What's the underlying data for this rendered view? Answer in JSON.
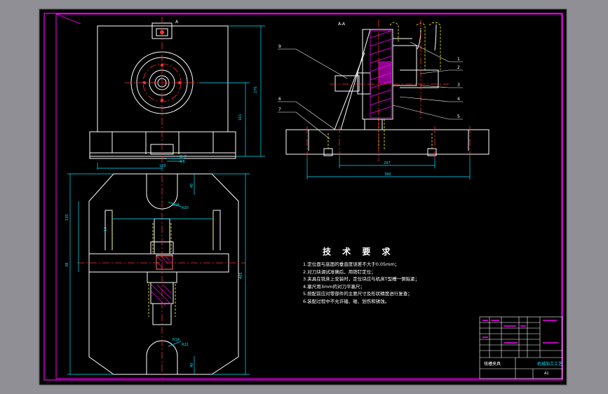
{
  "canvas": {
    "background": "#8f8f95",
    "sheet_background": "#000000"
  },
  "colors": {
    "border": "#ff00ff",
    "part_outline": "#ffffff",
    "dimension": "#00e5ff",
    "center_line": "#ff3030",
    "hidden_line": "#ffff00",
    "section_hatch": "#ff00ff",
    "leader": "#ffffff"
  },
  "views": {
    "section_label": "A-A",
    "section_marker": "A"
  },
  "requirements": {
    "title": "技 术 要 求",
    "items": [
      "1.定位面与底面的垂直度误差不大于0.05mm；",
      "2.对刀块调试准确后，用销钉定位；",
      "3.夹具在铣床上安装时，定位块应与机床T型槽一侧贴紧；",
      "4.塞尺用3mm的对刀平塞尺；",
      "5.按配前应对零部件的主要尺寸及形状精度进行复查；",
      "6.装配过程中不允许磕、碰、划伤和锈蚀。"
    ]
  },
  "title_block": {
    "drawing_name": "铣槽夹具",
    "school": "机械加工工艺",
    "sheet": "A1"
  },
  "leader_numbers": [
    "9",
    "6",
    "7",
    "1",
    "2",
    "3",
    "4",
    "5"
  ]
}
